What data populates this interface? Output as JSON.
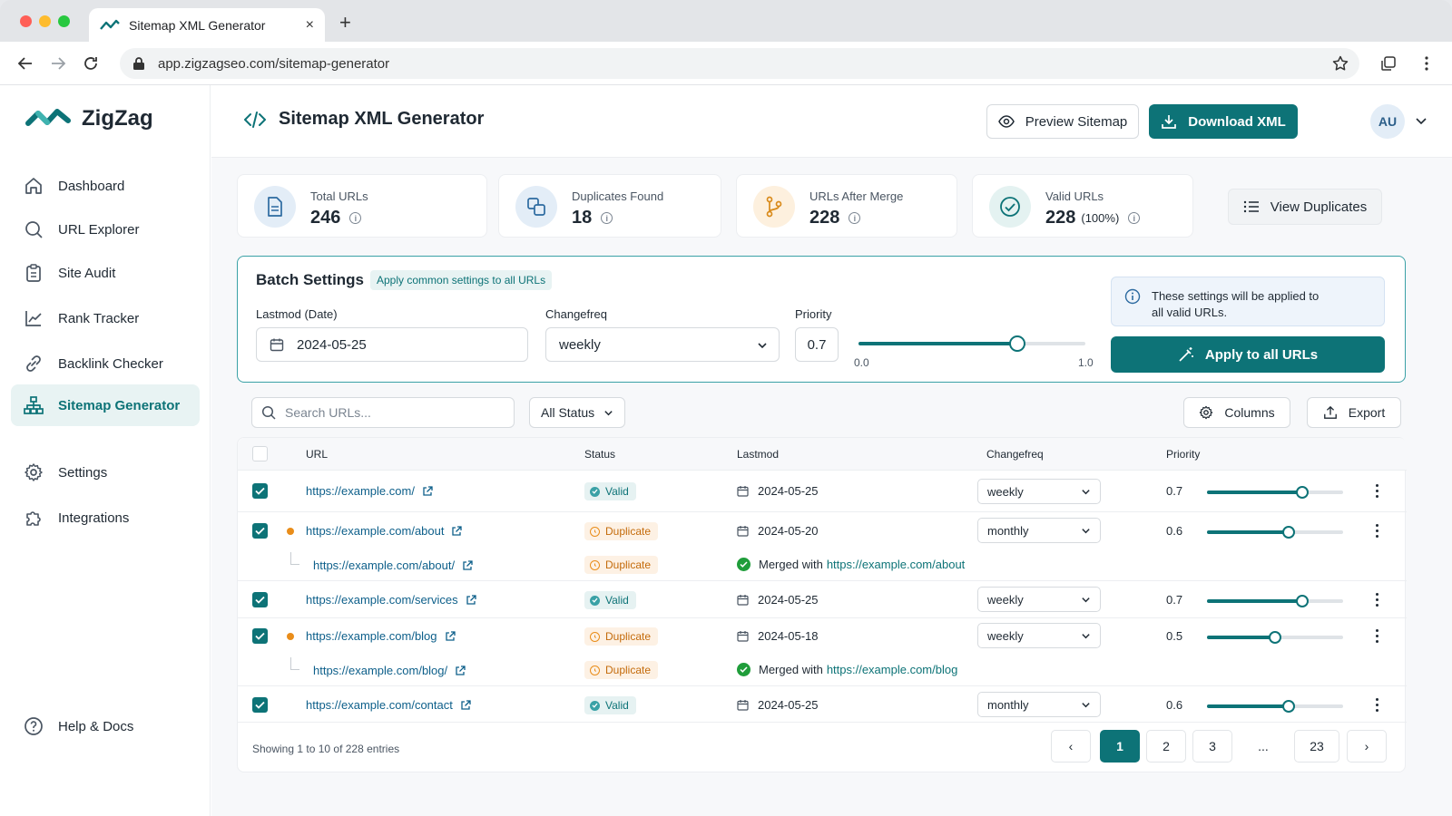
{
  "browser": {
    "tab_title": "Sitemap XML Generator",
    "tab_close": "×",
    "new_tab": "+",
    "url": "app.zigzagseo.com/sitemap-generator"
  },
  "brand": {
    "name": "ZigZag"
  },
  "sidebar": {
    "items": [
      {
        "label": "Dashboard",
        "icon": "home-icon"
      },
      {
        "label": "URL Explorer",
        "icon": "search-icon"
      },
      {
        "label": "Site Audit",
        "icon": "clipboard-icon"
      },
      {
        "label": "Rank Tracker",
        "icon": "line-chart-icon"
      },
      {
        "label": "Backlink Checker",
        "icon": "link-icon"
      },
      {
        "label": "Sitemap Generator",
        "icon": "sitemap-icon",
        "active": true
      },
      {
        "label": "Settings",
        "icon": "gear-icon"
      },
      {
        "label": "Integrations",
        "icon": "puzzle-icon"
      }
    ],
    "help_label": "Help & Docs"
  },
  "header": {
    "title": "Sitemap XML Generator",
    "preview_label": "Preview Sitemap",
    "download_label": "Download XML",
    "avatar_initials": "AU"
  },
  "stats": [
    {
      "label": "Total URLs",
      "value": "246"
    },
    {
      "label": "Duplicates Found",
      "value": "18"
    },
    {
      "label": "URLs After Merge",
      "value": "228"
    },
    {
      "label": "Valid URLs",
      "value": "228",
      "percent": "(100%)"
    }
  ],
  "view_duplicates_label": "View Duplicates",
  "batch": {
    "title": "Batch Settings",
    "chip": "Apply common settings to all URLs",
    "lastmod_label": "Lastmod (Date)",
    "lastmod_value": "2024-05-25",
    "changefreq_label": "Changefreq",
    "changefreq_value": "weekly",
    "priority_label": "Priority",
    "priority_value": "0.7",
    "priority_fraction": 0.7,
    "slider_min": "0.0",
    "slider_max": "1.0",
    "note": "These settings will be applied to all valid URLs.",
    "apply_label": "Apply to all URLs"
  },
  "toolbar": {
    "search_placeholder": "Search URLs...",
    "status_filter": "All Status",
    "columns_label": "Columns",
    "export_label": "Export"
  },
  "table": {
    "headers": {
      "url": "URL",
      "status": "Status",
      "lastmod": "Lastmod",
      "changefreq": "Changefreq",
      "priority": "Priority"
    },
    "rows": [
      {
        "url": "https://example.com/",
        "status": "Valid",
        "lastmod": "2024-05-25",
        "changefreq": "weekly",
        "priority": "0.7",
        "priority_fraction": 0.7
      },
      {
        "url": "https://example.com/about",
        "status": "Duplicate",
        "lastmod": "2024-05-20",
        "changefreq": "monthly",
        "priority": "0.6",
        "priority_fraction": 0.6
      },
      {
        "url": "https://example.com/about/",
        "status": "Duplicate",
        "merged_prefix": "Merged with",
        "merged_with": "https://example.com/about"
      },
      {
        "url": "https://example.com/services",
        "status": "Valid",
        "lastmod": "2024-05-25",
        "changefreq": "weekly",
        "priority": "0.7",
        "priority_fraction": 0.7
      },
      {
        "url": "https://example.com/blog",
        "status": "Duplicate",
        "lastmod": "2024-05-18",
        "changefreq": "weekly",
        "priority": "0.5",
        "priority_fraction": 0.5
      },
      {
        "url": "https://example.com/blog/",
        "status": "Duplicate",
        "merged_prefix": "Merged with",
        "merged_with": "https://example.com/blog"
      },
      {
        "url": "https://example.com/contact",
        "status": "Valid",
        "lastmod": "2024-05-25",
        "changefreq": "monthly",
        "priority": "0.6",
        "priority_fraction": 0.6
      }
    ],
    "footer": "Showing 1 to 10 of 228 entries"
  },
  "pagination": {
    "prev": "‹",
    "pages": [
      "1",
      "2",
      "3",
      "...",
      "23"
    ],
    "next": "›"
  },
  "colors": {
    "accent": "#0d7377",
    "duplicate": "#e98d1a",
    "merged": "#1f9d3a"
  }
}
